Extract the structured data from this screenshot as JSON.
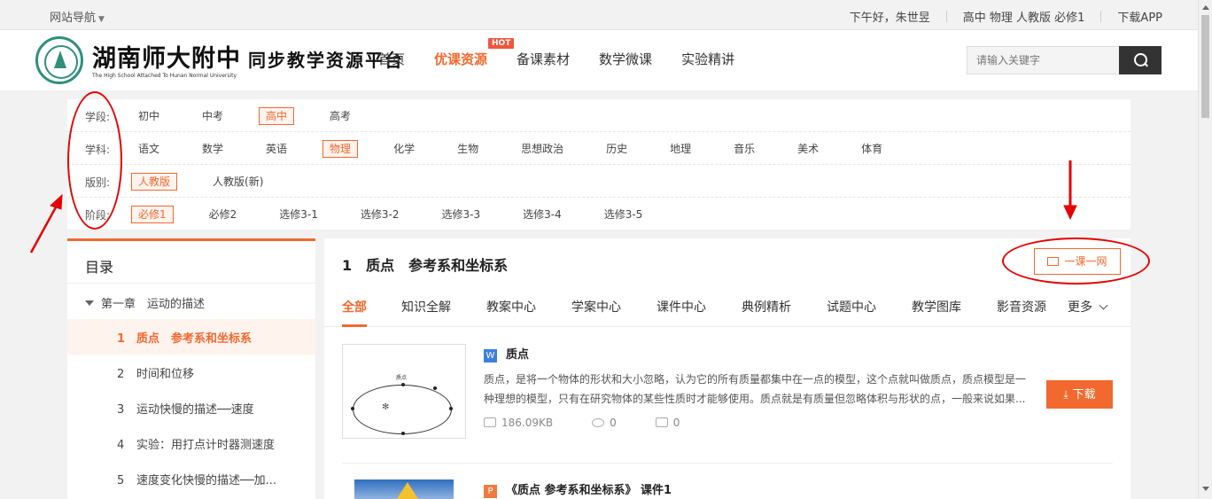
{
  "topbar": {
    "nav_guide": "网站导航",
    "greeting": "下午好，朱世昱",
    "current_selection": "高中 物理 人教版 必修1",
    "download_app": "下载APP"
  },
  "header": {
    "logo_title": "湖南师大附中",
    "logo_subtitle": "同步教学资源平台",
    "logo_english": "The High School Attached To Hunan Normal University",
    "nav": [
      "首页",
      "优课资源",
      "备课素材",
      "数学微课",
      "实验精讲"
    ],
    "hot_badge": "HOT",
    "search_placeholder": "请输入关键字"
  },
  "filters": {
    "stage": {
      "label": "学段:",
      "options": [
        "初中",
        "中考",
        "高中",
        "高考"
      ],
      "selected": "高中"
    },
    "subject": {
      "label": "学科:",
      "options": [
        "语文",
        "数学",
        "英语",
        "物理",
        "化学",
        "生物",
        "思想政治",
        "历史",
        "地理",
        "音乐",
        "美术",
        "体育"
      ],
      "selected": "物理"
    },
    "edition": {
      "label": "版别:",
      "options": [
        "人教版",
        "人教版(新)"
      ],
      "selected": "人教版"
    },
    "phase": {
      "label": "阶段:",
      "options": [
        "必修1",
        "必修2",
        "选修3-1",
        "选修3-2",
        "选修3-3",
        "选修3-4",
        "选修3-5"
      ],
      "selected": "必修1"
    }
  },
  "sidebar": {
    "heading": "目录",
    "chapter": "第一章　运动的描述",
    "lessons": [
      {
        "num": "1",
        "title": "质点　参考系和坐标系"
      },
      {
        "num": "2",
        "title": "时间和位移"
      },
      {
        "num": "3",
        "title": "运动快慢的描述──速度"
      },
      {
        "num": "4",
        "title": "实验：用打点计时器测速度"
      },
      {
        "num": "5",
        "title": "速度变化快慢的描述──加..."
      }
    ],
    "active_index": 0
  },
  "content": {
    "title": "1　质点　参考系和坐标系",
    "one_lesson_button": "一课一网",
    "tabs": [
      "全部",
      "知识全解",
      "教案中心",
      "学案中心",
      "课件中心",
      "典例精析",
      "试题中心",
      "教学图库",
      "影音资源",
      "更多"
    ],
    "active_tab": "全部",
    "resources": [
      {
        "type_icon": "W",
        "title": "质点",
        "description": "质点，是将一个物体的形状和大小忽略，认为它的所有质量都集中在一点的模型，这个点就叫做质点，质点模型是一种理想的模型，只有在研究物体的某些性质时才能够使用。质点就是有质量但忽略体积与形状的点，一般来说如果...",
        "size": "186.09KB",
        "views": "0",
        "downloads": "0",
        "download_label": "下载",
        "thumb_label": "质点"
      },
      {
        "type_icon": "P",
        "title": "《质点 参考系和坐标系》 课件1"
      }
    ]
  },
  "colors": {
    "accent": "#f2692f",
    "annotation": "#e60000"
  }
}
